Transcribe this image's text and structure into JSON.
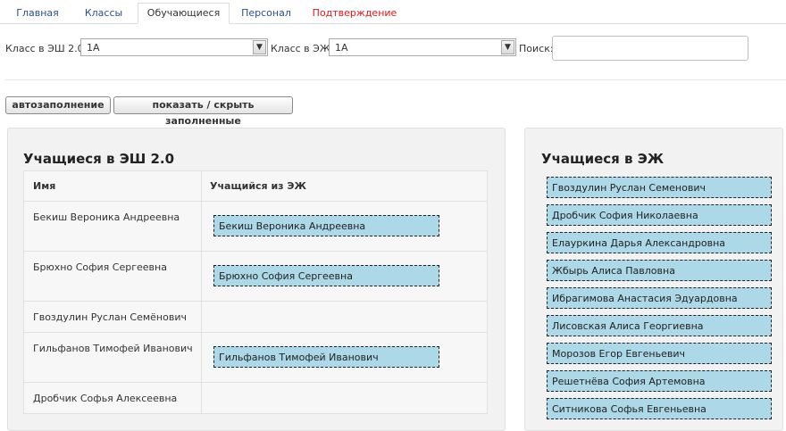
{
  "tabs": [
    {
      "label": "Главная"
    },
    {
      "label": "Классы"
    },
    {
      "label": "Обучающиеся"
    },
    {
      "label": "Персонал"
    },
    {
      "label": "Подтверждение"
    }
  ],
  "filters": {
    "esh_class_label": "Класс в ЭШ 2.0:",
    "esh_class_value": "1А",
    "ezh_class_label": "Класс в ЭЖ:",
    "ezh_class_value": "1А",
    "search_label": "Поиск:",
    "search_value": ""
  },
  "buttons": {
    "autofill": "автозаполнение",
    "toggle_filled": "показать / скрыть заполненные"
  },
  "left_panel": {
    "title": "Учащиеся в ЭШ 2.0",
    "col_name": "Имя",
    "col_match": "Учащийся из ЭЖ",
    "rows": [
      {
        "name": "Бекиш Вероника Андреевна",
        "match": "Бекиш Вероника Андреевна"
      },
      {
        "name": "Брюхно София Сергеевна",
        "match": "Брюхно София Сергеевна"
      },
      {
        "name": "Гвоздулин Руслан Семёнович",
        "match": ""
      },
      {
        "name": "Гильфанов Тимофей Иванович",
        "match": "Гильфанов Тимофей Иванович"
      },
      {
        "name": "Дробчик Софья Алексеевна",
        "match": ""
      }
    ]
  },
  "right_panel": {
    "title": "Учащиеся в ЭЖ",
    "students": [
      "Гвоздулин Руслан Семенович",
      "Дробчик София Николаевна",
      "Елауркина Дарья Александровна",
      "Жбырь Алиса Павловна",
      "Ибрагимова Анастасия Эдуардовна",
      "Лисовская Алиса Георгиевна",
      "Морозов Егор Евгеньевич",
      "Решетнёва София Артемовна",
      "Ситникова Софья Евгеньевна"
    ]
  },
  "colors": {
    "chip_bg": "#acd8e8",
    "tab_link": "#2a4f8f",
    "tab_alert": "#e01818"
  }
}
